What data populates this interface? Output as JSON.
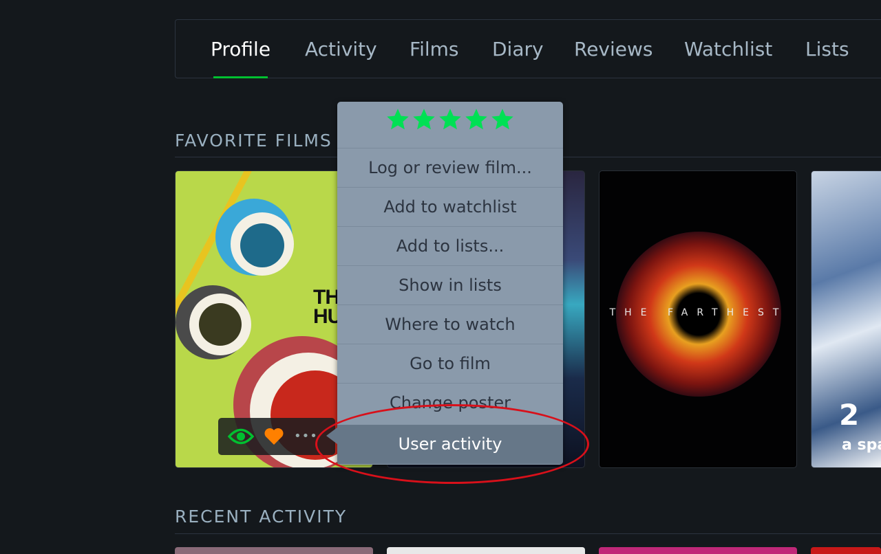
{
  "tabs": [
    {
      "label": "Profile",
      "active": true
    },
    {
      "label": "Activity"
    },
    {
      "label": "Films"
    },
    {
      "label": "Diary"
    },
    {
      "label": "Reviews"
    },
    {
      "label": "Watchlist"
    },
    {
      "label": "Lists"
    }
  ],
  "sections": {
    "favorites_title": "FAVORITE FILMS",
    "recent_title": "RECENT ACTIVITY"
  },
  "posters": {
    "poster1_title": "THE HUST",
    "poster3_text": "THE FARTHEST",
    "poster4_text_top": "2",
    "poster4_text_bottom": "a spa"
  },
  "poster_actions": {
    "watched_icon": "eye-icon",
    "like_icon": "heart-icon",
    "more_icon": "more-dots-icon",
    "dots": "•••"
  },
  "menu": {
    "rating_stars": 5,
    "items": [
      {
        "label": "Log or review film..."
      },
      {
        "label": "Add to watchlist"
      },
      {
        "label": "Add to lists..."
      },
      {
        "label": "Show in lists"
      },
      {
        "label": "Where to watch"
      },
      {
        "label": "Go to film"
      },
      {
        "label": "Change poster"
      },
      {
        "label": "User activity",
        "highlighted": true
      }
    ]
  },
  "colors": {
    "background": "#14181c",
    "accent_green": "#00c030",
    "star_green": "#00e054",
    "heart_orange": "#ff8000",
    "annotation_red": "#d8101a"
  }
}
